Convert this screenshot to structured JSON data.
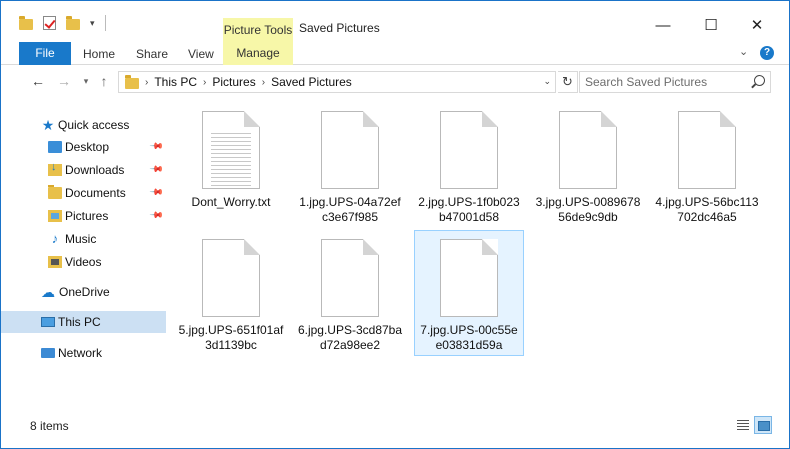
{
  "window": {
    "title": "Saved Pictures",
    "picture_tools": "Picture Tools",
    "controls": {
      "minimize": "—",
      "maximize": "☐",
      "close": "✕"
    }
  },
  "ribbon": {
    "file": "File",
    "home": "Home",
    "share": "Share",
    "view": "View",
    "manage": "Manage"
  },
  "address": {
    "breadcrumbs": [
      "This PC",
      "Pictures",
      "Saved Pictures"
    ]
  },
  "search": {
    "placeholder": "Search Saved Pictures"
  },
  "sidebar": {
    "quick_access": "Quick access",
    "items": [
      {
        "label": "Desktop",
        "icon": "desktop-icon",
        "pinned": true
      },
      {
        "label": "Downloads",
        "icon": "downloads-icon",
        "pinned": true
      },
      {
        "label": "Documents",
        "icon": "documents-icon",
        "pinned": true
      },
      {
        "label": "Pictures",
        "icon": "pictures-icon",
        "pinned": true
      },
      {
        "label": "Music",
        "icon": "music-icon",
        "pinned": false
      },
      {
        "label": "Videos",
        "icon": "videos-icon",
        "pinned": false
      }
    ],
    "onedrive": "OneDrive",
    "this_pc": "This PC",
    "network": "Network"
  },
  "files": [
    {
      "name": "Dont_Worry.txt",
      "type": "text"
    },
    {
      "name": "1.jpg.UPS-04a72efc3e67f985",
      "type": "blank"
    },
    {
      "name": "2.jpg.UPS-1f0b023b47001d58",
      "type": "blank"
    },
    {
      "name": "3.jpg.UPS-008967856de9c9db",
      "type": "blank"
    },
    {
      "name": "4.jpg.UPS-56bc113702dc46a5",
      "type": "blank"
    },
    {
      "name": "5.jpg.UPS-651f01af3d1139bc",
      "type": "blank"
    },
    {
      "name": "6.jpg.UPS-3cd87bad72a98ee2",
      "type": "blank"
    },
    {
      "name": "7.jpg.UPS-00c55ee03831d59a",
      "type": "blank",
      "selected": true
    }
  ],
  "status": {
    "item_count": "8 items"
  },
  "colors": {
    "accent": "#1979ca",
    "picture_tools": "#f7f7a8",
    "selection": "#cce0f3"
  }
}
